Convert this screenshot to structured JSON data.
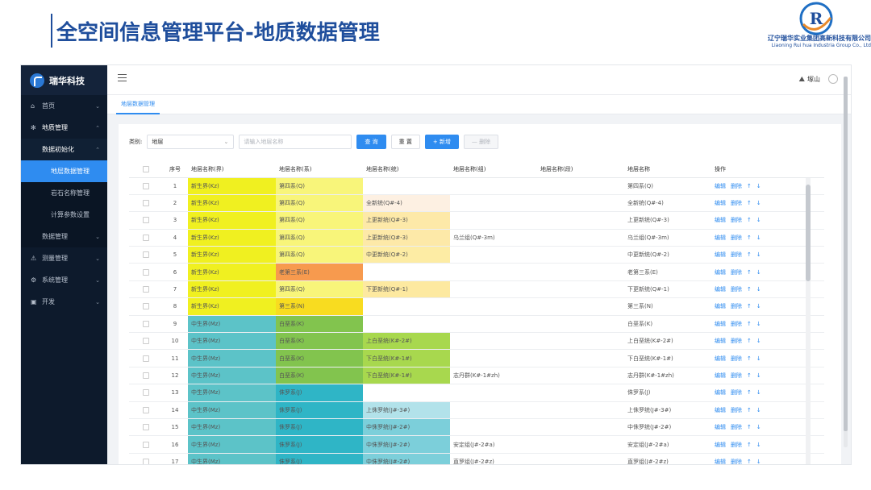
{
  "slide": {
    "title": "全空间信息管理平台-地质数据管理",
    "company_cn": "辽宁瑞华实业集团高新科技有限公司",
    "company_en": "Liaoning Rui hua Industria Group Co., Ltd",
    "logo_letter": "R"
  },
  "sidebar": {
    "brand": "瑞华科技",
    "items": [
      {
        "label": "首页",
        "icon": "home-icon"
      },
      {
        "label": "地质管理",
        "icon": "gear-icon"
      },
      {
        "label": "数据初始化"
      },
      {
        "label": "地层数据管理"
      },
      {
        "label": "岩石名称管理"
      },
      {
        "label": "计算参数设置"
      },
      {
        "label": "数据管理"
      },
      {
        "label": "测量管理",
        "icon": "warning-icon"
      },
      {
        "label": "系统管理",
        "icon": "settings-icon"
      },
      {
        "label": "开发",
        "icon": "code-icon"
      }
    ]
  },
  "topbar": {
    "user": "塚山"
  },
  "tabs": [
    {
      "label": "地层数据管理"
    }
  ],
  "filter": {
    "type_label": "类别:",
    "type_value": "地层",
    "search_placeholder": "请输入地层名称",
    "query_label": "查 询",
    "reset_label": "重 置",
    "add_label": "+ 新增",
    "delete_label": "— 删除"
  },
  "table": {
    "columns": [
      "序号",
      "地层名称(界)",
      "地层名称(系)",
      "地层名称(统)",
      "地层名称(组)",
      "地层名称(段)",
      "地层名称",
      "操作"
    ],
    "actions": [
      "编辑",
      "删除",
      "↑",
      "↓"
    ],
    "rows": [
      {
        "no": "1",
        "jie": "新生界(Kz)",
        "xi": "第四系(Q)",
        "tong": "",
        "zu": "",
        "duan": "",
        "name": "第四系(Q)"
      },
      {
        "no": "2",
        "jie": "新生界(Kz)",
        "xi": "第四系(Q)",
        "tong": "全新统(Q#-4)",
        "zu": "",
        "duan": "",
        "name": "全新统(Q#-4)"
      },
      {
        "no": "3",
        "jie": "新生界(Kz)",
        "xi": "第四系(Q)",
        "tong": "上更新统(Q#-3)",
        "zu": "",
        "duan": "",
        "name": "上更新统(Q#-3)"
      },
      {
        "no": "4",
        "jie": "新生界(Kz)",
        "xi": "第四系(Q)",
        "tong": "上更新统(Q#-3)",
        "zu": "乌兰组(Q#-3m)",
        "duan": "",
        "name": "乌兰组(Q#-3m)"
      },
      {
        "no": "5",
        "jie": "新生界(Kz)",
        "xi": "第四系(Q)",
        "tong": "中更新统(Q#-2)",
        "zu": "",
        "duan": "",
        "name": "中更新统(Q#-2)"
      },
      {
        "no": "6",
        "jie": "新生界(Kz)",
        "xi": "老第三系(E)",
        "tong": "",
        "zu": "",
        "duan": "",
        "name": "老第三系(E)"
      },
      {
        "no": "7",
        "jie": "新生界(Kz)",
        "xi": "第四系(Q)",
        "tong": "下更新统(Q#-1)",
        "zu": "",
        "duan": "",
        "name": "下更新统(Q#-1)"
      },
      {
        "no": "8",
        "jie": "新生界(Kz)",
        "xi": "第三系(N)",
        "tong": "",
        "zu": "",
        "duan": "",
        "name": "第三系(N)"
      },
      {
        "no": "9",
        "jie": "中生界(Mz)",
        "xi": "白垩系(K)",
        "tong": "",
        "zu": "",
        "duan": "",
        "name": "白垩系(K)"
      },
      {
        "no": "10",
        "jie": "中生界(Mz)",
        "xi": "白垩系(K)",
        "tong": "上白垩统(K#-2#)",
        "zu": "",
        "duan": "",
        "name": "上白垩统(K#-2#)"
      },
      {
        "no": "11",
        "jie": "中生界(Mz)",
        "xi": "白垩系(K)",
        "tong": "下白垩统(K#-1#)",
        "zu": "",
        "duan": "",
        "name": "下白垩统(K#-1#)"
      },
      {
        "no": "12",
        "jie": "中生界(Mz)",
        "xi": "白垩系(K)",
        "tong": "下白垩统(K#-1#)",
        "zu": "志丹群(K#-1#zh)",
        "duan": "",
        "name": "志丹群(K#-1#zh)"
      },
      {
        "no": "13",
        "jie": "中生界(Mz)",
        "xi": "侏罗系(J)",
        "tong": "",
        "zu": "",
        "duan": "",
        "name": "侏罗系(J)"
      },
      {
        "no": "14",
        "jie": "中生界(Mz)",
        "xi": "侏罗系(J)",
        "tong": "上侏罗统(J#-3#)",
        "zu": "",
        "duan": "",
        "name": "上侏罗统(J#-3#)"
      },
      {
        "no": "15",
        "jie": "中生界(Mz)",
        "xi": "侏罗系(J)",
        "tong": "中侏罗统(J#-2#)",
        "zu": "",
        "duan": "",
        "name": "中侏罗统(J#-2#)"
      },
      {
        "no": "16",
        "jie": "中生界(Mz)",
        "xi": "侏罗系(J)",
        "tong": "中侏罗统(J#-2#)",
        "zu": "安定组(J#-2#a)",
        "duan": "",
        "name": "安定组(J#-2#a)"
      },
      {
        "no": "17",
        "jie": "中生界(Mz)",
        "xi": "侏罗系(J)",
        "tong": "中侏罗统(J#-2#)",
        "zu": "直罗组(J#-2#z)",
        "duan": "",
        "name": "直罗组(J#-2#z)"
      }
    ],
    "colors": {
      "jie": [
        "#f0f020",
        "#f0f020",
        "#f0f020",
        "#f0f020",
        "#f0f020",
        "#f0f020",
        "#f0f020",
        "#f0f020",
        "#5cc3c8",
        "#5cc3c8",
        "#5cc3c8",
        "#5cc3c8",
        "#5cc3c8",
        "#5cc3c8",
        "#5cc3c8",
        "#5cc3c8",
        "#5cc3c8"
      ],
      "xi": [
        "#f8f57a",
        "#f8f57a",
        "#f8f57a",
        "#f8f57a",
        "#f8f57a",
        "#f79a4e",
        "#f8f57a",
        "#f8dc20",
        "#82c44e",
        "#82c44e",
        "#82c44e",
        "#82c44e",
        "#2fb5c6",
        "#2fb5c6",
        "#2fb5c6",
        "#2fb5c6",
        "#2fb5c6"
      ],
      "tong": [
        "",
        "#fdf0e2",
        "#fde9a8",
        "#fde9a8",
        "#fdeca4",
        "",
        "#fde9a0",
        "",
        "",
        "#a8d84e",
        "#a8d84e",
        "#a8d84e",
        "",
        "#b2e2ea",
        "#7ccfda",
        "#7ccfda",
        "#7ccfda"
      ]
    }
  }
}
